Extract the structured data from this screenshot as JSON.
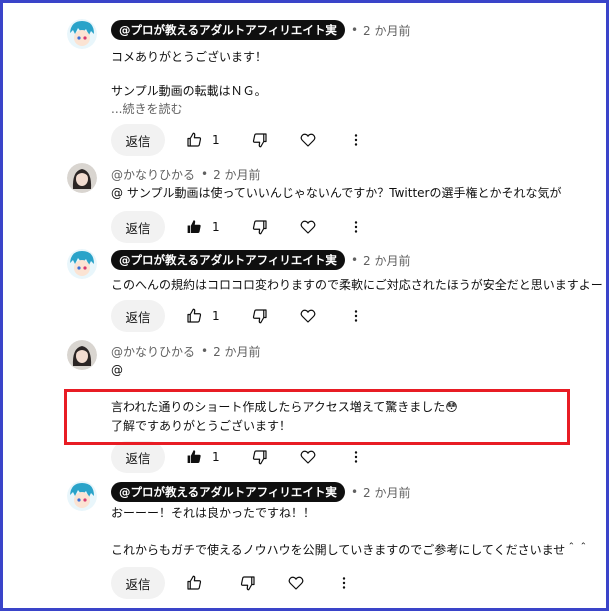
{
  "comments": [
    {
      "author": "@プロが教えるアダルトアフィリエイト実",
      "is_owner": true,
      "time": "2 か月前",
      "lines": [
        "コメありがとうございます！",
        "",
        "サンプル動画の転載はＮＧ。"
      ],
      "read_more": "...続きを読む",
      "reply_label": "返信",
      "likes": "1",
      "liked": false
    },
    {
      "author": "@かなりひかる",
      "is_owner": false,
      "time": "2 か月前",
      "lines": [
        "@ サンプル動画は使っていいんじゃないんですか？Twitterの選手権とかそれな気が"
      ],
      "reply_label": "返信",
      "likes": "1",
      "liked": true
    },
    {
      "author": "@プロが教えるアダルトアフィリエイト実",
      "is_owner": true,
      "time": "2 か月前",
      "lines": [
        "このへんの規約はコロコロ変わりますので柔軟にご対応されたほうが安全だと思いますよー"
      ],
      "reply_label": "返信",
      "likes": "1",
      "liked": false
    },
    {
      "author": "@かなりひかる",
      "is_owner": false,
      "time": "2 か月前",
      "lines": [
        "@",
        "",
        "言われた通りのショート作成したらアクセス増えて驚きました😳",
        "了解ですありがとうございます！"
      ],
      "reply_label": "返信",
      "likes": "1",
      "liked": true
    },
    {
      "author": "@プロが教えるアダルトアフィリエイト実",
      "is_owner": true,
      "time": "2 か月前",
      "lines": [
        "おーーー！それは良かったですね！！",
        "",
        "これからもガチで使えるノウハウを公開していきますのでご参考にしてくださいませ＾＾"
      ],
      "reply_label": "返信",
      "likes": "",
      "liked": false
    }
  ],
  "colors": {
    "frame_border": "#3a44c9",
    "highlight_border": "#e81c24",
    "badge_bg": "#0f0f0f",
    "secondary_text": "#606060"
  }
}
